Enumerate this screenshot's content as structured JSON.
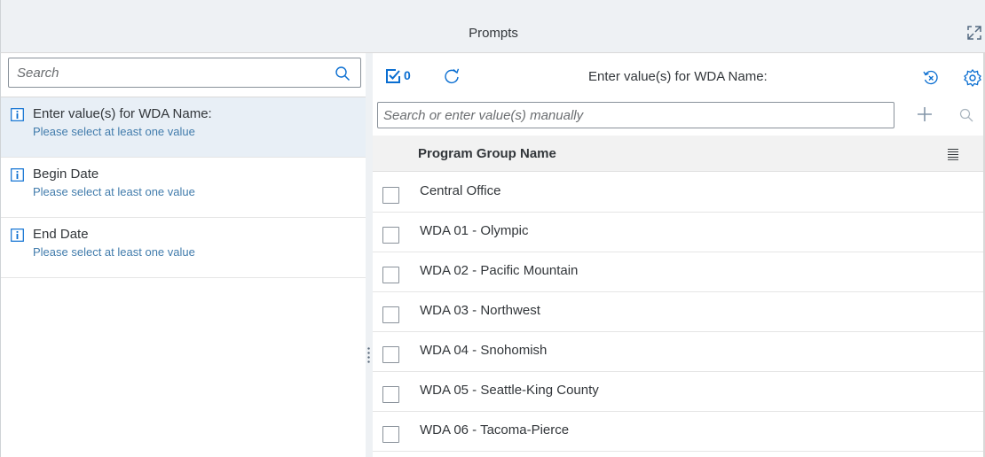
{
  "header": {
    "title": "Prompts",
    "expand_icon": "expand-icon"
  },
  "left_panel": {
    "search_placeholder": "Search",
    "prompts": [
      {
        "label": "Enter value(s) for WDA Name:",
        "hint": "Please select at least one value",
        "selected": true
      },
      {
        "label": "Begin Date",
        "hint": "Please select at least one value",
        "selected": false
      },
      {
        "label": "End Date",
        "hint": "Please select at least one value",
        "selected": false
      }
    ]
  },
  "right_panel": {
    "selected_count": "0",
    "title": "Enter value(s) for WDA Name:",
    "value_input_placeholder": "Search or enter value(s) manually",
    "column_header": "Program Group Name",
    "rows": [
      "Central Office",
      "WDA 01 - Olympic",
      "WDA 02 - Pacific Mountain",
      "WDA 03 - Northwest",
      "WDA 04 - Snohomish",
      "WDA 05 - Seattle-King County",
      "WDA 06 - Tacoma-Pierce"
    ]
  },
  "colors": {
    "accent": "#0a6ed1",
    "hint": "#427cac",
    "selected_bg": "#e8eff6",
    "header_bg": "#eef1f4"
  }
}
